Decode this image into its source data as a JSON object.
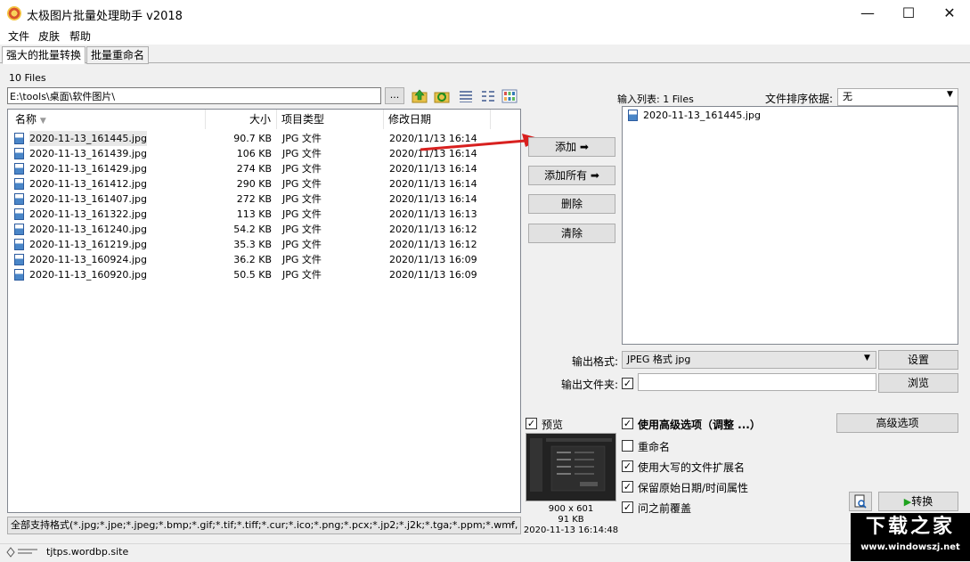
{
  "window": {
    "title": "太极图片批量处理助手  v2018",
    "minimize": "—",
    "maximize": "☐",
    "close": "✕"
  },
  "menu": [
    "文件",
    "皮肤",
    "帮助"
  ],
  "tabs": [
    {
      "label": "强大的批量转换",
      "active": true
    },
    {
      "label": "批量重命名",
      "active": false
    }
  ],
  "file_count": "10 Files",
  "path": {
    "value": "E:\\tools\\桌面\\软件图片\\",
    "browse_label": "..."
  },
  "toolbar_icons": [
    "up-folder-icon",
    "refresh-icon",
    "details-view-icon",
    "list-view-icon",
    "thumbnail-view-icon"
  ],
  "file_table": {
    "headers": [
      "名称",
      "大小",
      "项目类型",
      "修改日期"
    ],
    "rows": [
      {
        "name": "2020-11-13_161445.jpg",
        "size": "90.7 KB",
        "type": "JPG 文件",
        "date": "2020/11/13 16:14"
      },
      {
        "name": "2020-11-13_161439.jpg",
        "size": "106 KB",
        "type": "JPG 文件",
        "date": "2020/11/13 16:14"
      },
      {
        "name": "2020-11-13_161429.jpg",
        "size": "274 KB",
        "type": "JPG 文件",
        "date": "2020/11/13 16:14"
      },
      {
        "name": "2020-11-13_161412.jpg",
        "size": "290 KB",
        "type": "JPG 文件",
        "date": "2020/11/13 16:14"
      },
      {
        "name": "2020-11-13_161407.jpg",
        "size": "272 KB",
        "type": "JPG 文件",
        "date": "2020/11/13 16:14"
      },
      {
        "name": "2020-11-13_161322.jpg",
        "size": "113 KB",
        "type": "JPG 文件",
        "date": "2020/11/13 16:13"
      },
      {
        "name": "2020-11-13_161240.jpg",
        "size": "54.2 KB",
        "type": "JPG 文件",
        "date": "2020/11/13 16:12"
      },
      {
        "name": "2020-11-13_161219.jpg",
        "size": "35.3 KB",
        "type": "JPG 文件",
        "date": "2020/11/13 16:12"
      },
      {
        "name": "2020-11-13_160924.jpg",
        "size": "36.2 KB",
        "type": "JPG 文件",
        "date": "2020/11/13 16:09"
      },
      {
        "name": "2020-11-13_160920.jpg",
        "size": "50.5 KB",
        "type": "JPG 文件",
        "date": "2020/11/13 16:09"
      }
    ]
  },
  "filter": "全部支持格式(*.jpg;*.jpe;*.jpeg;*.bmp;*.gif;*.tif;*.tiff;*.cur;*.ico;*.png;*.pcx;*.jp2;*.j2k;*.tga;*.ppm;*.wmf,",
  "actions": {
    "add": "添加 ➡",
    "add_all": "添加所有 ➡",
    "delete": "删除",
    "clear": "清除"
  },
  "input_list": {
    "label": "输入列表: 1 Files",
    "sort_label": "文件排序依据:",
    "sort_value": "无",
    "items": [
      "2020-11-13_161445.jpg"
    ]
  },
  "output": {
    "format_label": "输出格式:",
    "format_value": "JPEG 格式 jpg",
    "settings_button": "设置",
    "folder_label": "输出文件夹:",
    "folder_value": "",
    "browse_button": "浏览"
  },
  "preview": {
    "label": "预览",
    "dimensions": "900 x 601",
    "size": "91 KB",
    "date": "2020-11-13 16:14:48"
  },
  "options": {
    "advanced_checkbox": "使用高级选项（调整 ...）",
    "advanced_button": "高级选项",
    "rename": "重命名",
    "uppercase_ext": "使用大写的文件扩展名",
    "keep_date": "保留原始日期/时间属性",
    "ask_overwrite": "问之前覆盖",
    "convert_button": "转换"
  },
  "status": {
    "text": "tjtps.wordbp.site"
  },
  "watermark": {
    "line1": "下载之家",
    "line2": "www.windowszj.net"
  }
}
